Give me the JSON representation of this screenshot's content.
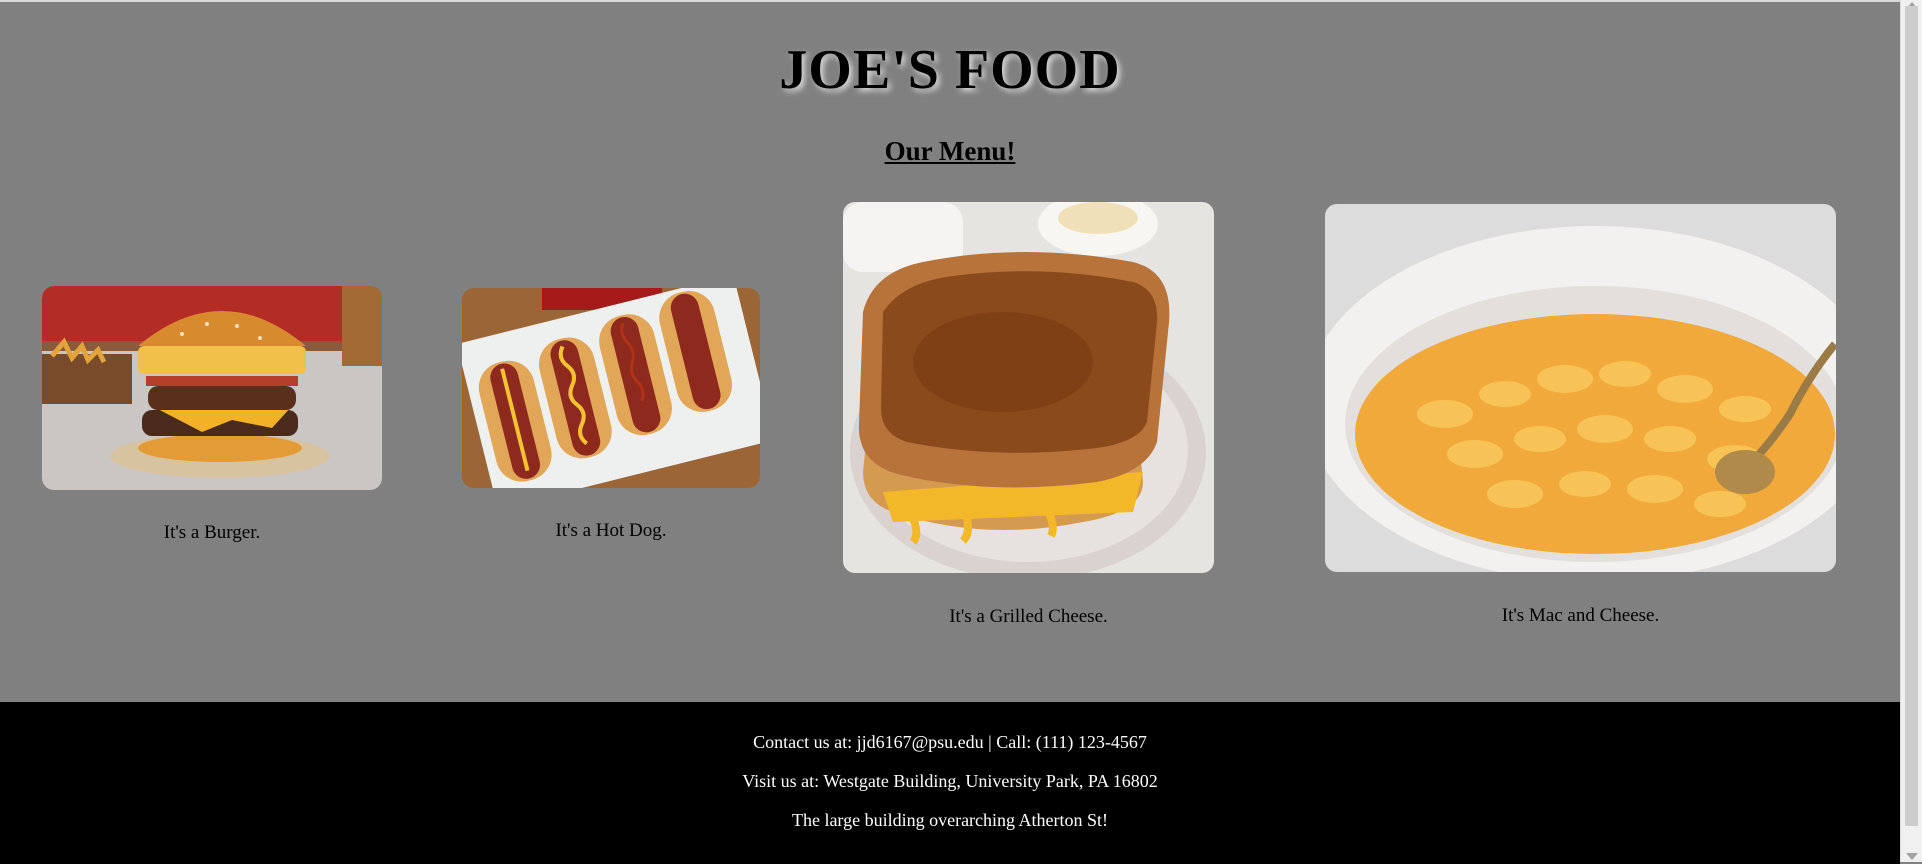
{
  "header": {
    "title": "JOE'S FOOD",
    "subtitle": "Our Menu!"
  },
  "menu": {
    "items": [
      {
        "caption": "It's a Burger.",
        "image": "burger"
      },
      {
        "caption": "It's a Hot Dog.",
        "image": "hot-dogs"
      },
      {
        "caption": "It's a Grilled Cheese.",
        "image": "grilled-cheese"
      },
      {
        "caption": "It's Mac and Cheese.",
        "image": "mac-and-cheese"
      }
    ]
  },
  "footer": {
    "contact": "Contact us at: jjd6167@psu.edu | Call: (111) 123-4567",
    "address": "Visit us at: Westgate Building, University Park, PA 16802",
    "note": "The large building overarching Atherton St!"
  },
  "colors": {
    "page_background": "#808080",
    "footer_background": "#000000",
    "footer_text": "#ffffff"
  }
}
